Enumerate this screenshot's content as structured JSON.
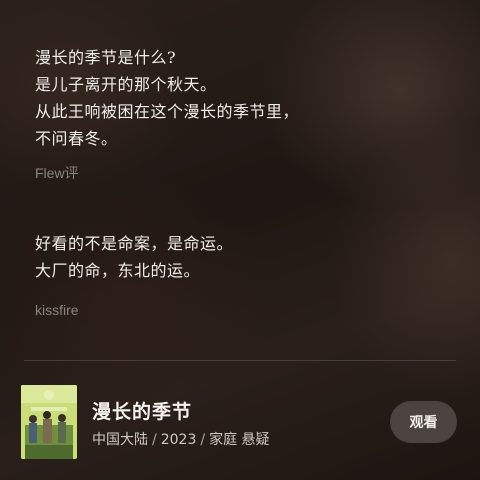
{
  "reviews": [
    {
      "lines": [
        "漫长的季节是什么?",
        "是儿子离开的那个秋天。",
        "从此王响被困在这个漫长的季节里，",
        "不问春冬。"
      ],
      "author": "Flew评"
    },
    {
      "lines": [
        "好看的不是命案，是命运。",
        "大厂的命，东北的运。"
      ],
      "author": "kissfire"
    }
  ],
  "movie": {
    "title": "漫长的季节",
    "region": "中国大陆",
    "year": "2023",
    "genres": "家庭 悬疑",
    "separator": "/",
    "poster_icon": "movie-poster-image",
    "watch_label": "观看"
  },
  "colors": {
    "background": "#241a16",
    "text_primary": "#f2eeea",
    "text_secondary": "#8a8480",
    "button_bg": "#4a433f"
  }
}
